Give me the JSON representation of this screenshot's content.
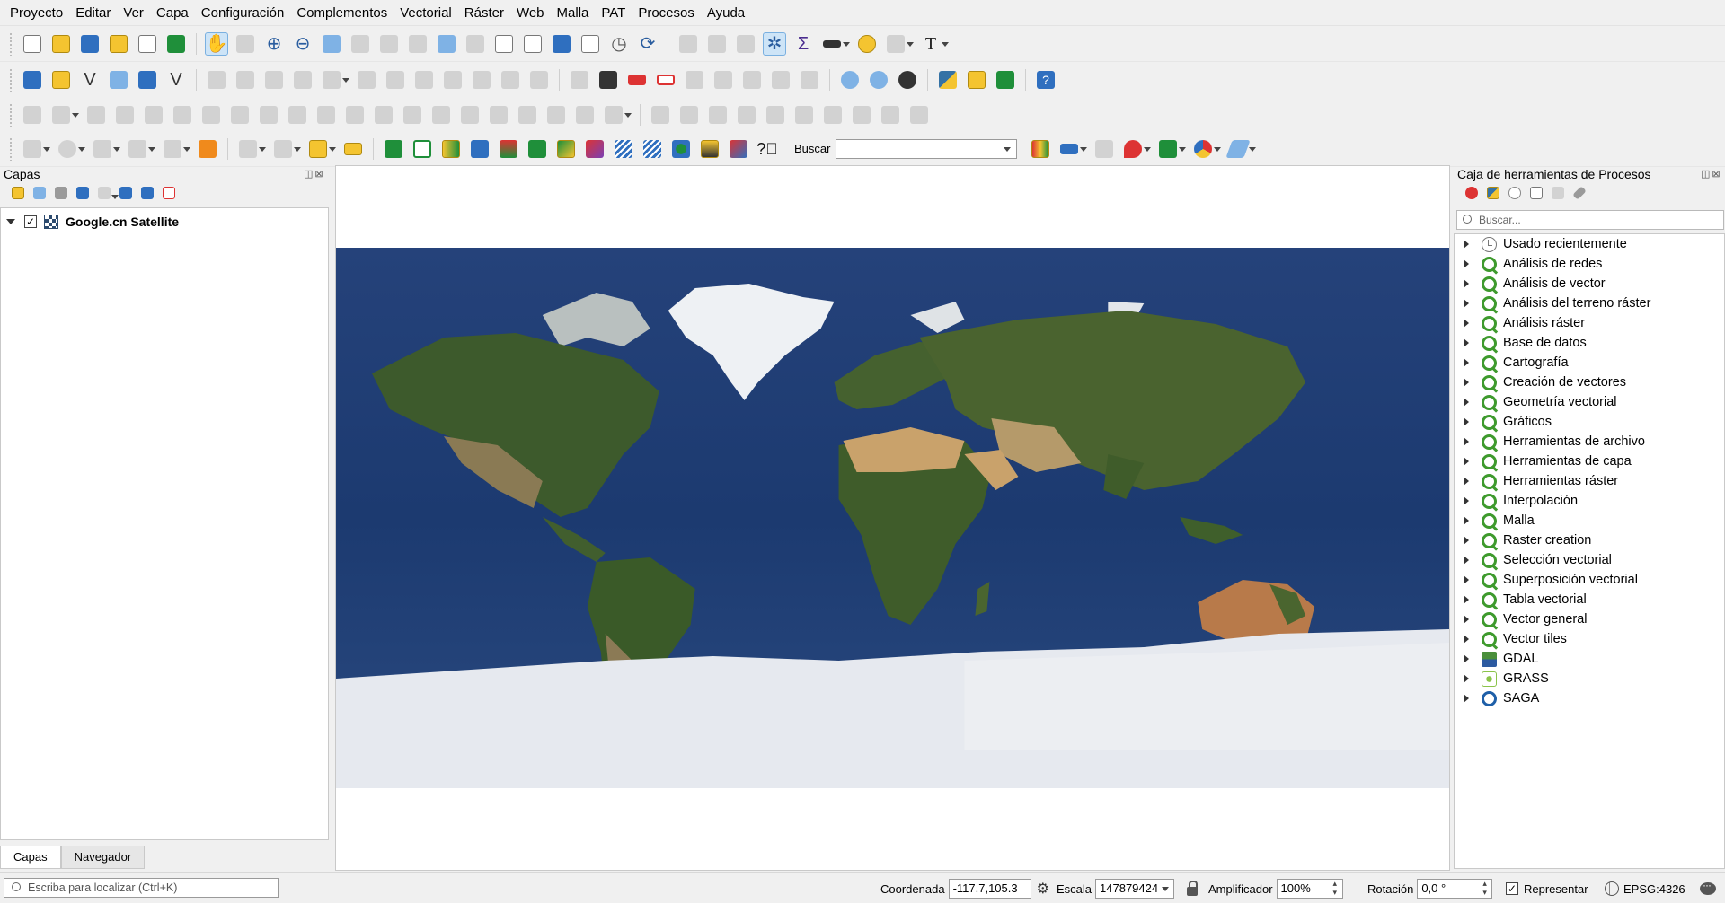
{
  "menu": [
    "Proyecto",
    "Editar",
    "Ver",
    "Capa",
    "Configuración",
    "Complementos",
    "Vectorial",
    "Ráster",
    "Web",
    "Malla",
    "PAT",
    "Procesos",
    "Ayuda"
  ],
  "search_toolbar": {
    "label": "Buscar",
    "value": ""
  },
  "layers_panel": {
    "title": "Capas",
    "panel_buttons": "◫⊠",
    "layer": {
      "name": "Google.cn Satellite",
      "checked": "✓"
    },
    "tabs": [
      "Capas",
      "Navegador"
    ]
  },
  "processing_panel": {
    "title": "Caja de herramientas de Procesos",
    "panel_buttons": "◫⊠",
    "search_placeholder": "Buscar...",
    "items": [
      {
        "label": "Usado recientemente",
        "icon": "clock-icon"
      },
      {
        "label": "Análisis de redes",
        "icon": "qgis-icon"
      },
      {
        "label": "Análisis de vector",
        "icon": "qgis-icon"
      },
      {
        "label": "Análisis del terreno ráster",
        "icon": "qgis-icon"
      },
      {
        "label": "Análisis ráster",
        "icon": "qgis-icon"
      },
      {
        "label": "Base de datos",
        "icon": "qgis-icon"
      },
      {
        "label": "Cartografía",
        "icon": "qgis-icon"
      },
      {
        "label": "Creación de vectores",
        "icon": "qgis-icon"
      },
      {
        "label": "Geometría vectorial",
        "icon": "qgis-icon"
      },
      {
        "label": "Gráficos",
        "icon": "qgis-icon"
      },
      {
        "label": "Herramientas de archivo",
        "icon": "qgis-icon"
      },
      {
        "label": "Herramientas de capa",
        "icon": "qgis-icon"
      },
      {
        "label": "Herramientas ráster",
        "icon": "qgis-icon"
      },
      {
        "label": "Interpolación",
        "icon": "qgis-icon"
      },
      {
        "label": "Malla",
        "icon": "qgis-icon"
      },
      {
        "label": "Raster creation",
        "icon": "qgis-icon"
      },
      {
        "label": "Selección vectorial",
        "icon": "qgis-icon"
      },
      {
        "label": "Superposición vectorial",
        "icon": "qgis-icon"
      },
      {
        "label": "Tabla vectorial",
        "icon": "qgis-icon"
      },
      {
        "label": "Vector general",
        "icon": "qgis-icon"
      },
      {
        "label": "Vector tiles",
        "icon": "qgis-icon"
      },
      {
        "label": "GDAL",
        "icon": "gdal-icon"
      },
      {
        "label": "GRASS",
        "icon": "grass-icon"
      },
      {
        "label": "SAGA",
        "icon": "saga-icon"
      }
    ]
  },
  "statusbar": {
    "locator_placeholder": "Escriba para localizar (Ctrl+K)",
    "coordinate_label": "Coordenada",
    "coordinate_value": "-117.7,105.3",
    "scale_label": "Escala",
    "scale_value": "147879424",
    "magnifier_label": "Amplificador",
    "magnifier_value": "100%",
    "rotation_label": "Rotación",
    "rotation_value": "0,0 °",
    "render_label": "Representar",
    "render_checked": "✓",
    "crs": "EPSG:4326"
  },
  "colors": {
    "ocean": "#1f3f75",
    "ice": "#e6e9ef",
    "land": "#3f5d2a",
    "desert": "#c9a26b",
    "qgis_green": "#3e9a2d"
  }
}
